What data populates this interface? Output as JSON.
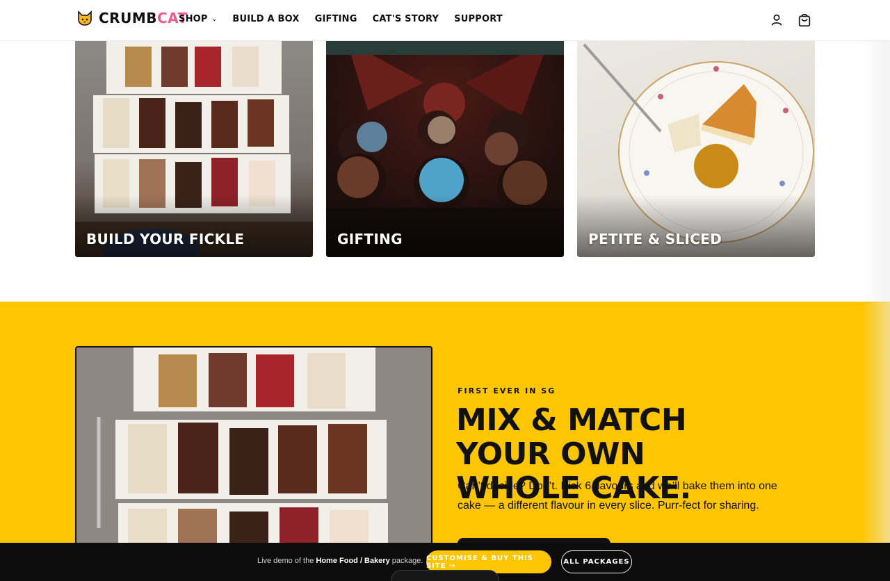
{
  "brand": {
    "name_part1": "CRUMB",
    "name_part2": "CAT",
    "accent": "#ef5b8a"
  },
  "nav": {
    "items": [
      {
        "label": "SHOP",
        "has_dropdown": true
      },
      {
        "label": "BUILD A BOX"
      },
      {
        "label": "GIFTING"
      },
      {
        "label": "CAT'S STORY"
      },
      {
        "label": "SUPPORT"
      }
    ],
    "icons": [
      "account-icon",
      "cart-icon"
    ]
  },
  "categories": [
    {
      "title": "BUILD YOUR FICKLE"
    },
    {
      "title": "GIFTING"
    },
    {
      "title": "PETITE & SLICED"
    }
  ],
  "promo": {
    "kicker": "FIRST EVER IN SG",
    "title": "MIX & MATCH YOUR OWN WHOLE CAKE.",
    "body": "Can’t decide? Don’t. Pick 6 flavours and we’ll bake them into one cake — a different flavour in every slice. Purr-fect for sharing.",
    "background": "#fdc601"
  },
  "demo_bar": {
    "text_prefix": "Live demo of the ",
    "text_bold": "Home Food / Bakery",
    "text_suffix": " package.",
    "primary_button": "CUSTOMISE & BUY THIS SITE →",
    "secondary_button": "ALL PACKAGES"
  }
}
